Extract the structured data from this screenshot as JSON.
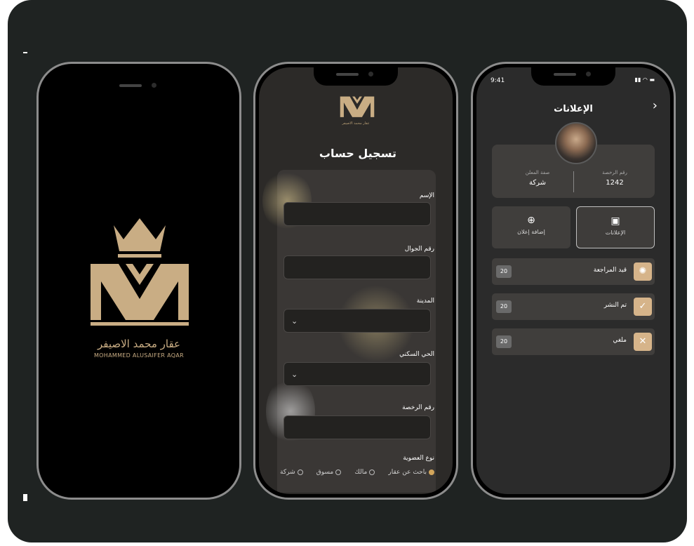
{
  "brand": {
    "name_ar": "عقار محمد الاصيفر",
    "name_en": "MOHAMMED ALUSAIFER AQAR"
  },
  "registration": {
    "title": "تسجيل حساب",
    "fields": {
      "name_label": "الإسم",
      "mobile_label": "رقم الجوال",
      "city_label": "المدينة",
      "district_label": "الحي السكني",
      "license_label": "رقم الرخصة"
    },
    "membership": {
      "label": "نوع العضوية",
      "options": [
        "باحث عن عقار",
        "مالك",
        "مسوق",
        "شركة"
      ],
      "selected": "باحث عن عقار"
    }
  },
  "ads": {
    "status_time": "9:41",
    "title": "الإعلانات",
    "profile": {
      "license_label": "رقم الرخصة",
      "license_value": "1242",
      "role_label": "صفة المعلن",
      "role_value": "شركة"
    },
    "tiles": {
      "ads_label": "الإعلانات",
      "add_label": "إضافة إعلان"
    },
    "stats": [
      {
        "label": "قيد المراجعة",
        "count": "20",
        "icon": "spinner-icon"
      },
      {
        "label": "تم النشر",
        "count": "20",
        "icon": "check-icon"
      },
      {
        "label": "ملغي",
        "count": "20",
        "icon": "close-icon"
      }
    ]
  },
  "colors": {
    "canvas": "#1f2322",
    "gold": "#c9ad84",
    "badge": "#d6b48a",
    "radio_on": "#d2a55b"
  }
}
